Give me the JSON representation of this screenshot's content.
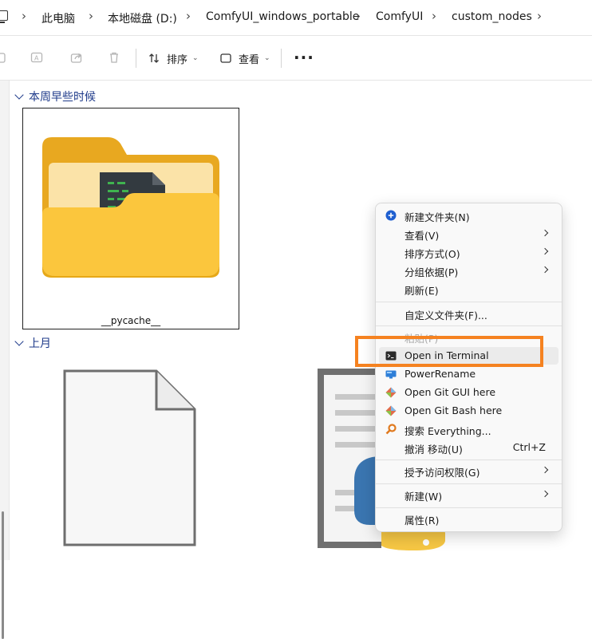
{
  "address_bar": {
    "crumbs": [
      "此电脑",
      "本地磁盘 (D:)",
      "ComfyUI_windows_portable",
      "ComfyUI",
      "custom_nodes"
    ]
  },
  "toolbar": {
    "sort_label": "排序",
    "view_label": "查看",
    "more_label": "···"
  },
  "groups": [
    {
      "label": "本周早些时候",
      "items": [
        {
          "name": "__pycache__",
          "type": "folder"
        }
      ]
    },
    {
      "label": "上月"
    }
  ],
  "context_menu": {
    "items": [
      {
        "label": "新建文件夹(N)",
        "icon": "add-circle-icon"
      },
      {
        "label": "查看(V)",
        "submenu": true
      },
      {
        "label": "排序方式(O)",
        "submenu": true
      },
      {
        "label": "分组依据(P)",
        "submenu": true
      },
      {
        "label": "刷新(E)"
      },
      {
        "label": "自定义文件夹(F)..."
      },
      {
        "label": "粘贴(P)",
        "disabled": true
      },
      {
        "label": "Open in Terminal",
        "icon": "terminal-icon",
        "highlighted": true
      },
      {
        "label": "PowerRename",
        "icon": "powerrename-icon"
      },
      {
        "label": "Open Git GUI here",
        "icon": "git-icon"
      },
      {
        "label": "Open Git Bash here",
        "icon": "git-icon"
      },
      {
        "label": "搜索 Everything...",
        "icon": "everything-search-icon"
      },
      {
        "label": "撤消 移动(U)",
        "shortcut": "Ctrl+Z"
      },
      {
        "label": "授予访问权限(G)",
        "submenu": true
      },
      {
        "label": "新建(W)",
        "submenu": true
      },
      {
        "label": "属性(R)"
      }
    ]
  },
  "colors": {
    "accent": "#1e3a8a",
    "highlight_box": "#f58220",
    "folder_yellow": "#f7c948"
  }
}
